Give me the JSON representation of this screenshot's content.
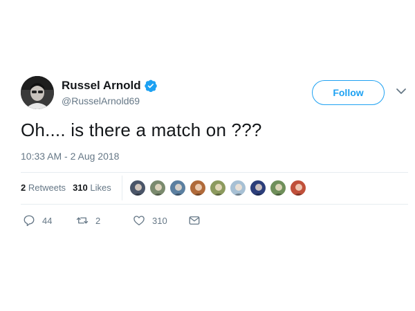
{
  "user": {
    "name": "Russel Arnold",
    "handle": "@RusselArnold69",
    "verified": true
  },
  "follow_label": "Follow",
  "tweet": {
    "text": "Oh.... is there a match on ???",
    "timestamp": "10:33 AM - 2 Aug 2018"
  },
  "stats": {
    "retweets_count": "2",
    "retweets_label": "Retweets",
    "likes_count": "310",
    "likes_label": "Likes"
  },
  "likers": [
    {
      "name": "liker-avatar-1",
      "color": "#4a5568"
    },
    {
      "name": "liker-avatar-2",
      "color": "#7a8a6e"
    },
    {
      "name": "liker-avatar-3",
      "color": "#5b7fa0"
    },
    {
      "name": "liker-avatar-4",
      "color": "#b06a3a"
    },
    {
      "name": "liker-avatar-5",
      "color": "#8c9a5e"
    },
    {
      "name": "liker-avatar-6",
      "color": "#a7c0d4"
    },
    {
      "name": "liker-avatar-7",
      "color": "#2c3e7a"
    },
    {
      "name": "liker-avatar-8",
      "color": "#6f8f5a"
    },
    {
      "name": "liker-avatar-9",
      "color": "#c0503a"
    }
  ],
  "actions": {
    "reply_count": "44",
    "retweet_count": "2",
    "like_count": "310"
  },
  "colors": {
    "accent": "#1da1f2",
    "secondary_text": "#657786",
    "primary_text": "#14171a",
    "divider": "#e6ecf0"
  },
  "icons": [
    "verified-badge-icon",
    "chevron-down-icon",
    "reply-icon",
    "retweet-icon",
    "heart-icon",
    "envelope-icon"
  ]
}
